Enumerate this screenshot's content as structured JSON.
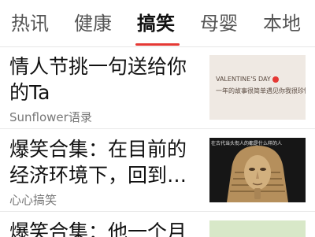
{
  "tabs": [
    {
      "label": "热讯",
      "active": false
    },
    {
      "label": "健康",
      "active": false
    },
    {
      "label": "搞笑",
      "active": true
    },
    {
      "label": "母婴",
      "active": false
    },
    {
      "label": "本地",
      "active": false
    }
  ],
  "colors": {
    "accent": "#e53935"
  },
  "feed": [
    {
      "title": "情人节挑一句送给你的Ta",
      "source": "Sunflower语录",
      "thumb": {
        "line1": "VALENTINE'S DAY",
        "line2": "一年的故事很简单遇见你我很珍惜"
      }
    },
    {
      "title": "爆笑合集：在目前的经济环境下，回到…",
      "source": "心心搞笑",
      "thumb": {
        "caption": "在古代当头衔人的都是什么样的人"
      }
    },
    {
      "title": "爆笑合集：他一个月"
    }
  ]
}
